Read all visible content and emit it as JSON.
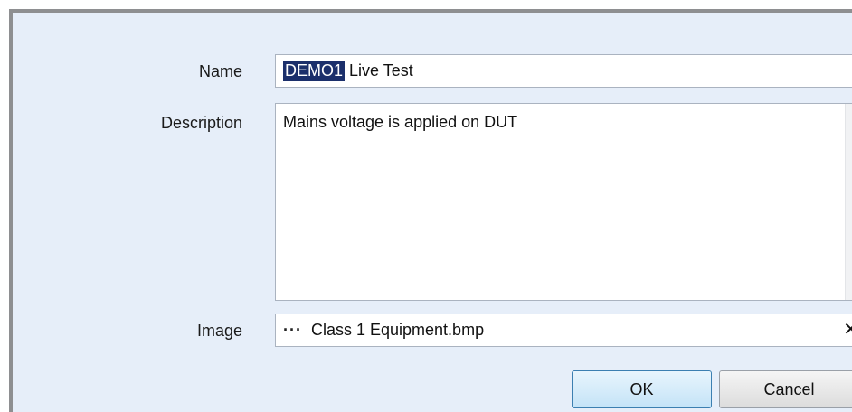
{
  "form": {
    "name_label": "Name",
    "name_selected": "DEMO1",
    "name_rest": " Live Test",
    "description_label": "Description",
    "description_value": "Mains voltage is applied on DUT",
    "image_label": "Image",
    "image_browse": "···",
    "image_value": "Class 1 Equipment.bmp",
    "image_clear": "✕"
  },
  "buttons": {
    "ok": "OK",
    "cancel": "Cancel"
  },
  "icons": {
    "scroll_up": "▲",
    "scroll_down": "▼"
  }
}
